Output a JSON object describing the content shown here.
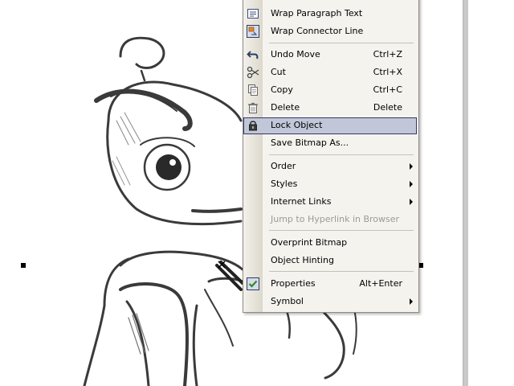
{
  "context_menu": {
    "items": {
      "wrap_paragraph": {
        "label": "Wrap Paragraph Text",
        "icon": "wrap-paragraph-icon"
      },
      "wrap_connector": {
        "label": "Wrap Connector Line",
        "icon": "wrap-connector-icon"
      },
      "undo_move": {
        "label": "Undo Move",
        "shortcut": "Ctrl+Z",
        "icon": "undo-icon"
      },
      "cut": {
        "label": "Cut",
        "shortcut": "Ctrl+X",
        "icon": "scissors-icon"
      },
      "copy": {
        "label": "Copy",
        "shortcut": "Ctrl+C",
        "icon": "copy-icon"
      },
      "delete": {
        "label": "Delete",
        "shortcut": "Delete",
        "icon": "trash-icon"
      },
      "lock_object": {
        "label": "Lock Object",
        "icon": "lock-icon",
        "highlighted": true
      },
      "save_bitmap": {
        "label": "Save Bitmap As..."
      },
      "order": {
        "label": "Order",
        "submenu": true
      },
      "styles": {
        "label": "Styles",
        "submenu": true
      },
      "internet_links": {
        "label": "Internet Links",
        "submenu": true
      },
      "jump_hyperlink": {
        "label": "Jump to Hyperlink in Browser",
        "disabled": true
      },
      "overprint_bitmap": {
        "label": "Overprint Bitmap"
      },
      "object_hinting": {
        "label": "Object Hinting"
      },
      "properties": {
        "label": "Properties",
        "shortcut": "Alt+Enter",
        "icon": "checkmark-icon",
        "checked": true
      },
      "symbol": {
        "label": "Symbol",
        "submenu": true
      }
    }
  },
  "colors": {
    "menu_background": "#f5f3ee",
    "highlight_fill": "#c1c7d8",
    "highlight_border": "#2f3a6b",
    "disabled_text": "#9b9a96",
    "check_green": "#2e8b2e"
  }
}
